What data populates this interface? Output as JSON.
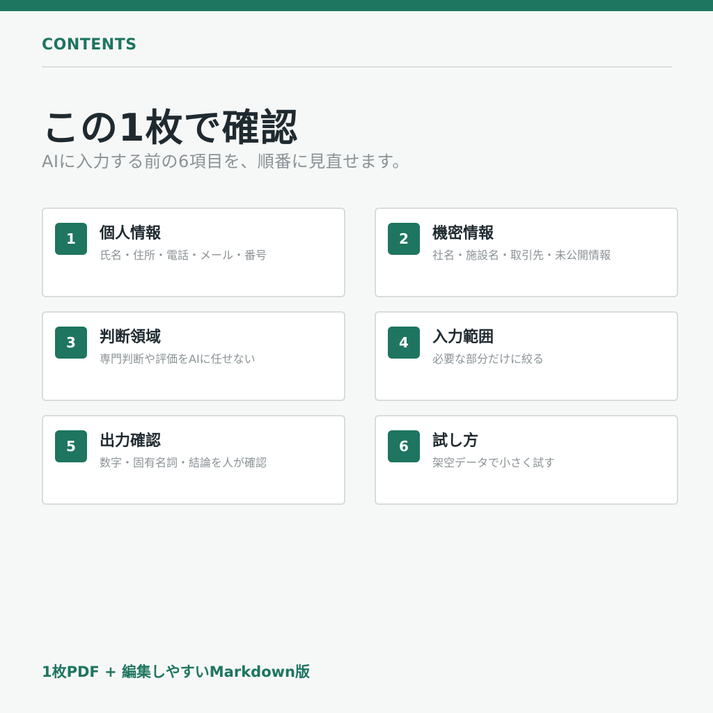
{
  "header": {
    "section_label": "CONTENTS",
    "title": "この1枚で確認",
    "subtitle": "AIに入力する前の6項目を、順番に見直せます。"
  },
  "items": [
    {
      "number": "1",
      "title": "個人情報",
      "description": "氏名・住所・電話・メール・番号"
    },
    {
      "number": "2",
      "title": "機密情報",
      "description": "社名・施設名・取引先・未公開情報"
    },
    {
      "number": "3",
      "title": "判断領域",
      "description": "専門判断や評価をAIに任せない"
    },
    {
      "number": "4",
      "title": "入力範囲",
      "description": "必要な部分だけに絞る"
    },
    {
      "number": "5",
      "title": "出力確認",
      "description": "数字・固有名詞・結論を人が確認"
    },
    {
      "number": "6",
      "title": "試し方",
      "description": "架空データで小さく試す"
    }
  ],
  "footer": {
    "note": "1枚PDF + 編集しやすいMarkdown版"
  },
  "colors": {
    "accent": "#1e7560",
    "background": "#f6f8f7",
    "text": "#1f2a30",
    "muted": "#8a9296",
    "border": "#d8dddc"
  }
}
